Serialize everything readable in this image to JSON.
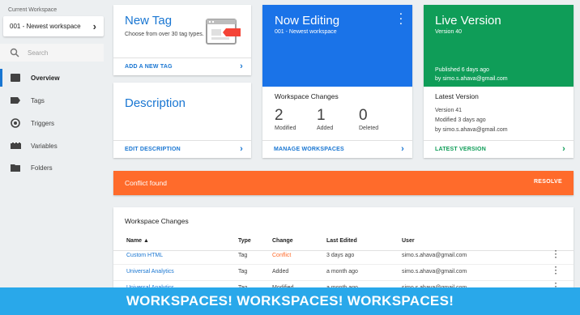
{
  "sidebar": {
    "workspace_label": "Current Workspace",
    "workspace_value": "001 - Newest workspace",
    "search_placeholder": "Search",
    "items": [
      {
        "label": "Overview",
        "icon": "overview-icon"
      },
      {
        "label": "Tags",
        "icon": "tag-icon"
      },
      {
        "label": "Triggers",
        "icon": "trigger-icon"
      },
      {
        "label": "Variables",
        "icon": "variables-icon"
      },
      {
        "label": "Folders",
        "icon": "folder-icon"
      }
    ]
  },
  "new_tag": {
    "title": "New Tag",
    "description": "Choose from over 30 tag types.",
    "action": "ADD A NEW TAG"
  },
  "description_card": {
    "title": "Description",
    "action": "EDIT DESCRIPTION"
  },
  "now_editing": {
    "title": "Now Editing",
    "workspace": "001 - Newest workspace",
    "changes_title": "Workspace Changes",
    "stats": [
      {
        "value": "2",
        "label": "Modified"
      },
      {
        "value": "1",
        "label": "Added"
      },
      {
        "value": "0",
        "label": "Deleted"
      }
    ],
    "action": "MANAGE WORKSPACES"
  },
  "live_version": {
    "title": "Live Version",
    "version": "Version 40",
    "published": "Published 6 days ago",
    "published_by": "by simo.s.ahava@gmail.com",
    "latest_title": "Latest Version",
    "latest_version": "Version 41",
    "latest_modified": "Modified 3 days ago",
    "latest_by": "by simo.s.ahava@gmail.com",
    "action": "LATEST VERSION"
  },
  "conflict": {
    "message": "Conflict found",
    "action": "RESOLVE"
  },
  "changes_table": {
    "title": "Workspace Changes",
    "columns": [
      "Name ▲",
      "Type",
      "Change",
      "Last Edited",
      "User"
    ],
    "rows": [
      {
        "name": "Custom HTML",
        "type": "Tag",
        "change": "Conflict",
        "edited": "3 days ago",
        "user": "simo.s.ahava@gmail.com"
      },
      {
        "name": "Universal Analytics",
        "type": "Tag",
        "change": "Added",
        "edited": "a month ago",
        "user": "simo.s.ahava@gmail.com"
      },
      {
        "name": "Universal Analytics",
        "type": "Tag",
        "change": "Modified",
        "edited": "a month ago",
        "user": "simo.s.ahava@gmail.com"
      }
    ]
  },
  "banner": {
    "text": "WORKSPACES! WORKSPACES! WORKSPACES!"
  },
  "colors": {
    "primary_blue": "#1a73e8",
    "live_green": "#0f9d58",
    "conflict_orange": "#ff6b2b",
    "banner_blue": "#29a8ea"
  }
}
